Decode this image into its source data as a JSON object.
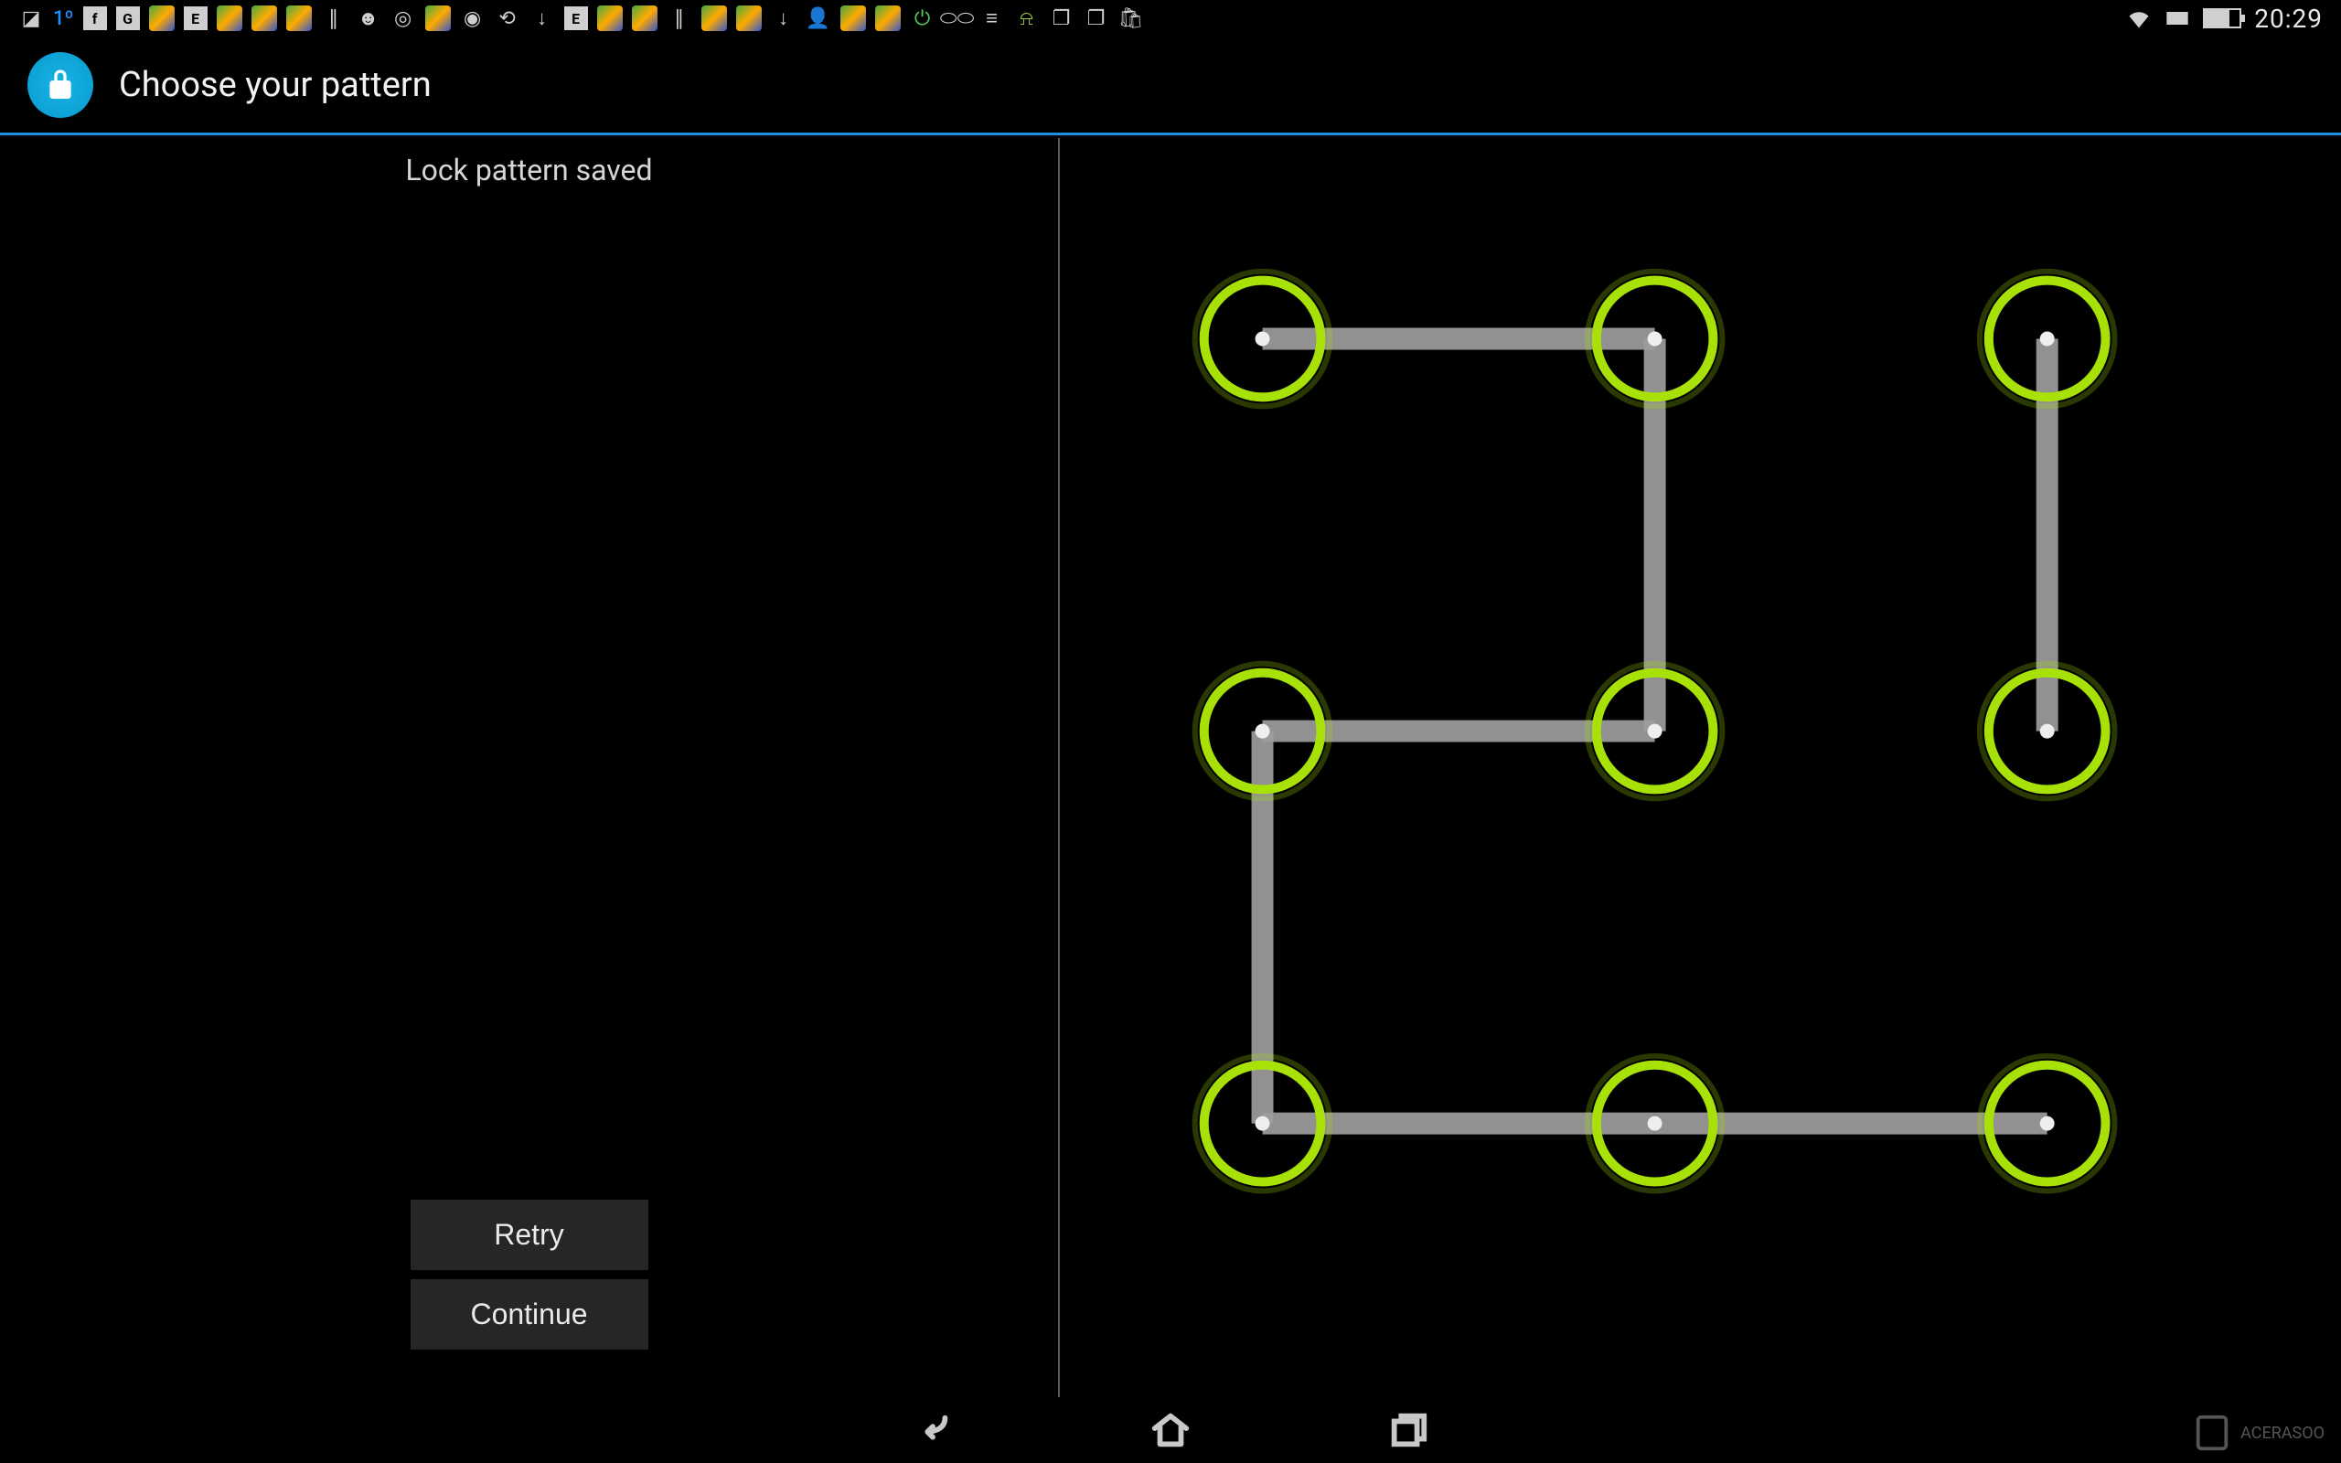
{
  "statusbar": {
    "temperature": "1º",
    "clock": "20:29"
  },
  "appbar": {
    "title": "Choose your pattern"
  },
  "left": {
    "status_text": "Lock pattern saved",
    "retry_label": "Retry",
    "continue_label": "Continue"
  },
  "pattern": {
    "dot_color": "#a8e108",
    "line_color": "#9e9e9e",
    "dots_active": [
      1,
      2,
      3,
      4,
      5,
      6,
      7,
      8,
      9
    ],
    "path_sequence": [
      1,
      2,
      5,
      4,
      7,
      8,
      9
    ],
    "extra_segments": [
      [
        3,
        6
      ]
    ]
  },
  "watermark": {
    "text": "ACERASOO"
  }
}
